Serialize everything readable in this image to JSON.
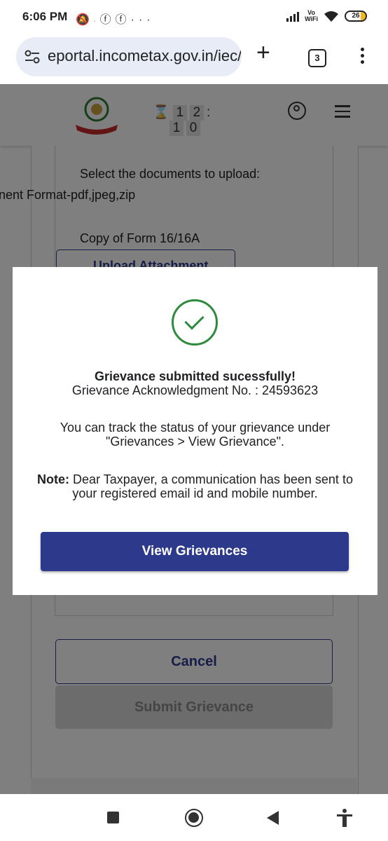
{
  "status_bar": {
    "time": "6:06 PM",
    "icons": [
      "bell-off-icon",
      "network-icon",
      "facebook-icon",
      "facebook-icon",
      "more-icon"
    ],
    "vowifi_top": "Vo",
    "vowifi_bottom": "WiFi",
    "battery": "26"
  },
  "browser": {
    "url": "eportal.incometax.gov.in/iec/",
    "tab_count": "3"
  },
  "site_header": {
    "timer_digits": [
      "1",
      "2",
      ":",
      "1",
      "0"
    ]
  },
  "page": {
    "select_documents": "Select the documents to upload:",
    "format_text": "nent Format-pdf,jpeg,zip",
    "form_label": "Copy of Form 16/16A",
    "upload_button": "Upload Attachment",
    "cancel_button": "Cancel",
    "submit_button": "Submit Grievance"
  },
  "modal": {
    "title": "Grievance submitted sucessfully!",
    "ack_text": "Grievance Acknowledgment No. : 24593623",
    "track_text": "You can track the status of your grievance under \"Grievances > View Grievance\".",
    "note_label": "Note:",
    "note_text": " Dear Taxpayer, a communication has been sent to your registered email id and mobile number.",
    "view_button": "View Grievances"
  },
  "colors": {
    "primary": "#2d3a8c",
    "success": "#2e8b3d"
  }
}
